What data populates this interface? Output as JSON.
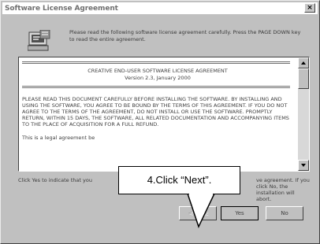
{
  "window": {
    "title": "Software License Agreement",
    "close_label": "×"
  },
  "icons": {
    "setup": "setup-computer-icon",
    "close": "close-icon",
    "scroll_up": "arrow-up-icon",
    "scroll_down": "arrow-down-icon"
  },
  "intro": {
    "text": "Please read the following software license agreement carefully. Press the PAGE DOWN key to read the entire agreement."
  },
  "license": {
    "title": "CREATIVE END-USER SOFTWARE LICENSE AGREEMENT",
    "version": "Version 2.3, January 2000",
    "body": "PLEASE READ THIS DOCUMENT CAREFULLY BEFORE INSTALLING THE SOFTWARE. BY INSTALLING AND USING THE SOFTWARE, YOU AGREE TO BE BOUND BY THE TERMS OF THIS AGREEMENT. IF YOU DO NOT AGREE TO THE TERMS OF THE AGREEMENT, DO NOT INSTALL OR USE THE SOFTWARE. PROMPTLY RETURN, WITHIN 15 DAYS, THE SOFTWARE, ALL RELATED DOCUMENTATION AND ACCOMPANYING ITEMS TO THE PLACE OF ACQUISITION FOR A FULL REFUND.",
    "tail": "This is a legal agreement be"
  },
  "question": {
    "text": "Click Yes to indicate that you",
    "tail": "ve agreement. If you click No, the installation will abort."
  },
  "buttons": {
    "back": "< Back",
    "yes": "Yes",
    "no": "No"
  },
  "callout": {
    "text": "4.Click “Next”."
  },
  "colors": {
    "dialog_face": "#c0c0c0",
    "text": "#404040",
    "callout_border": "#000000"
  }
}
